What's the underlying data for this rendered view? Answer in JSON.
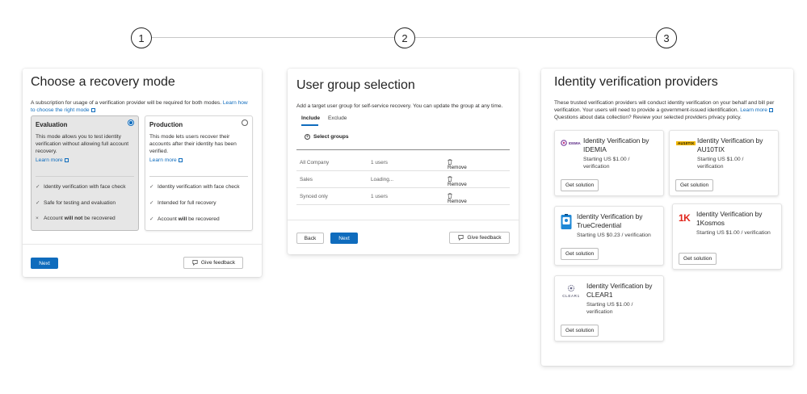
{
  "stepper": {
    "steps": [
      "1",
      "2",
      "3"
    ]
  },
  "recovery": {
    "title": "Choose a recovery mode",
    "description": "A subscription for usage of a verification provider will be required for both modes.",
    "description_link": "Learn how to choose the right mode",
    "modes": [
      {
        "title": "Evaluation",
        "selected": true,
        "description": "This mode allows you to test identity verification without allowing full account recovery.",
        "learn_more": "Learn more",
        "features": [
          {
            "icon": "check-icon",
            "text": "Identity verification with face check"
          },
          {
            "icon": "check-icon",
            "text": "Safe for testing and evaluation"
          },
          {
            "icon": "x-icon",
            "pre": "Account ",
            "bold": "will not",
            "post": " be recovered"
          }
        ]
      },
      {
        "title": "Production",
        "selected": false,
        "description": "This mode lets users recover their accounts after their identity has been verified.",
        "learn_more": "Learn more",
        "features": [
          {
            "icon": "check-icon",
            "text": "Identity verification with face check"
          },
          {
            "icon": "check-icon",
            "text": "Intended for full recovery"
          },
          {
            "icon": "check-icon",
            "pre": "Account ",
            "bold": "will",
            "post": " be recovered"
          }
        ]
      }
    ],
    "next_label": "Next",
    "feedback_label": "Give feedback"
  },
  "groups": {
    "title": "User group selection",
    "description": "Add a target user group for self-service recovery. You can update the group at any time.",
    "tabs": [
      {
        "label": "Include",
        "active": true
      },
      {
        "label": "Exclude",
        "active": false
      }
    ],
    "select_label": "Select groups",
    "rows": [
      {
        "name": "All Company",
        "users": "1 users",
        "action": "Remove"
      },
      {
        "name": "Sales",
        "users": "Loading...",
        "action": "Remove"
      },
      {
        "name": "Synced only",
        "users": "1 users",
        "action": "Remove"
      }
    ],
    "back_label": "Back",
    "next_label": "Next",
    "feedback_label": "Give feedback"
  },
  "providers": {
    "title": "Identity verification providers",
    "description": "These trusted verification providers will conduct identity verification on your behalf and bill per verification. Your users will need to provide a government-issued identification.",
    "learn_more": "Learn more",
    "privacy_note": "Questions about data collection? Review your selected providers privacy policy.",
    "items": [
      {
        "name": "Identity Verification by IDEMIA",
        "price": "Starting US $1.00 / verification",
        "logo_text": "IDEMIA",
        "button": "Get solution"
      },
      {
        "name": "Identity Verification by AU10TIX",
        "price": "Starting US $1.00 / verification",
        "logo_text": "AU10TIX",
        "button": "Get solution"
      },
      {
        "name": "Identity Verification by TrueCredential",
        "price": "Starting US $0.23 / verification",
        "logo_text": "",
        "button": "Get solution"
      },
      {
        "name": "Identity Verification by 1Kosmos",
        "price": "Starting US $1.00 / verification",
        "logo_text": "1K",
        "button": "Get solution"
      },
      {
        "name": "Identity Verification by CLEAR1",
        "price": "Starting US $1.00 / verification",
        "logo_text": "CLEAR1",
        "button": "Get solution"
      }
    ]
  }
}
